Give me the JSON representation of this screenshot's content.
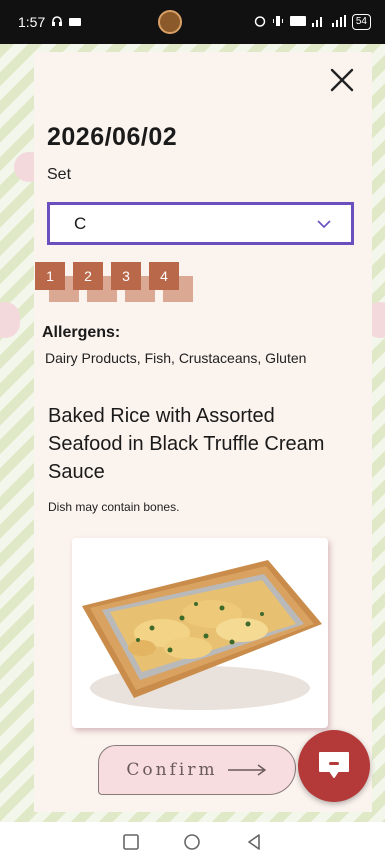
{
  "status_bar": {
    "time": "1:57",
    "battery": "54"
  },
  "modal": {
    "date": "2026/06/02",
    "set_label": "Set",
    "set_selected": "C",
    "tabs": [
      {
        "label": "1"
      },
      {
        "label": "2"
      },
      {
        "label": "3"
      },
      {
        "label": "4"
      }
    ],
    "allergens_heading": "Allergens:",
    "allergens": "Dairy Products, Fish, Crustaceans, Gluten",
    "dish_name": "Baked Rice with Assorted Seafood in Black Truffle Cream Sauce",
    "dish_note": "Dish may contain bones.",
    "confirm_label": "Confirm"
  },
  "colors": {
    "select_border": "#6b4fbf",
    "tab_bg": "#b9694a",
    "confirm_bg": "#f7dde0",
    "chat_fab": "#b43a3a"
  },
  "icons": [
    "close-icon",
    "chevron-down-icon",
    "arrow-right-icon",
    "chat-icon",
    "nav-square-icon",
    "nav-circle-icon",
    "nav-back-icon"
  ]
}
